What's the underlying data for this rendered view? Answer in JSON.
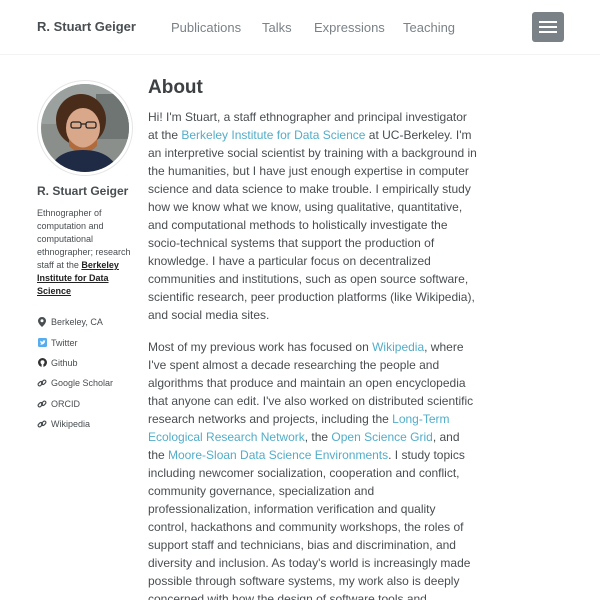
{
  "header": {
    "site_title": "R. Stuart Geiger",
    "nav": [
      "Publications",
      "Talks",
      "Expressions",
      "Teaching"
    ]
  },
  "sidebar": {
    "name": "R. Stuart Geiger",
    "bio_text": "Ethnographer of computation and computational ethnographer; research staff at the ",
    "bio_link": "Berkeley Institute for Data Science",
    "links": [
      {
        "icon": "map-marker-icon",
        "label": "Berkeley, CA"
      },
      {
        "icon": "twitter-icon",
        "label": "Twitter"
      },
      {
        "icon": "github-icon",
        "label": "Github"
      },
      {
        "icon": "link-icon",
        "label": "Google Scholar"
      },
      {
        "icon": "link-icon",
        "label": "ORCID"
      },
      {
        "icon": "link-icon",
        "label": "Wikipedia"
      }
    ]
  },
  "main": {
    "title": "About",
    "p1": {
      "a": "Hi! I'm Stuart, a staff ethnographer and principal investigator at the ",
      "link1": "Berkeley Institute for Data Science",
      "b": " at UC-Berkeley. I'm an interpretive social scientist by training with a background in the humanities, but I have just enough expertise in computer science and data science to make trouble. I empirically study how we know what we know, using qualitative, quantitative, and computational methods to holistically investigate the socio-technical systems that support the production of knowledge. I have a particular focus on decentralized communities and institutions, such as open source software, scientific research, peer production platforms (like Wikipedia), and social media sites."
    },
    "p2": {
      "a": "Most of my previous work has focused on ",
      "link1": "Wikipedia",
      "b": ", where I've spent almost a decade researching the people and algorithms that produce and maintain an open encyclopedia that anyone can edit. I've also worked on distributed scientific research networks and projects, including the ",
      "link2": "Long-Term Ecological Research Network",
      "c": ", the ",
      "link3": "Open Science Grid",
      "d": ", and the ",
      "link4": "Moore-Sloan Data Science Environments",
      "e": ". I study topics including newcomer socialization, cooperation and conflict, community governance, specialization and professionalization, information verification and quality control, hackathons and community workshops, the roles of support staff and technicians, bias and discrimination, and diversity and inclusion. As today's world is increasingly made possible through software systems, my work also is deeply concerned with how the design of software tools and"
    }
  },
  "colors": {
    "text": "#494e52",
    "link": "#52adc8",
    "nav_text": "#7a8288",
    "menu_button": "#7a8288"
  }
}
